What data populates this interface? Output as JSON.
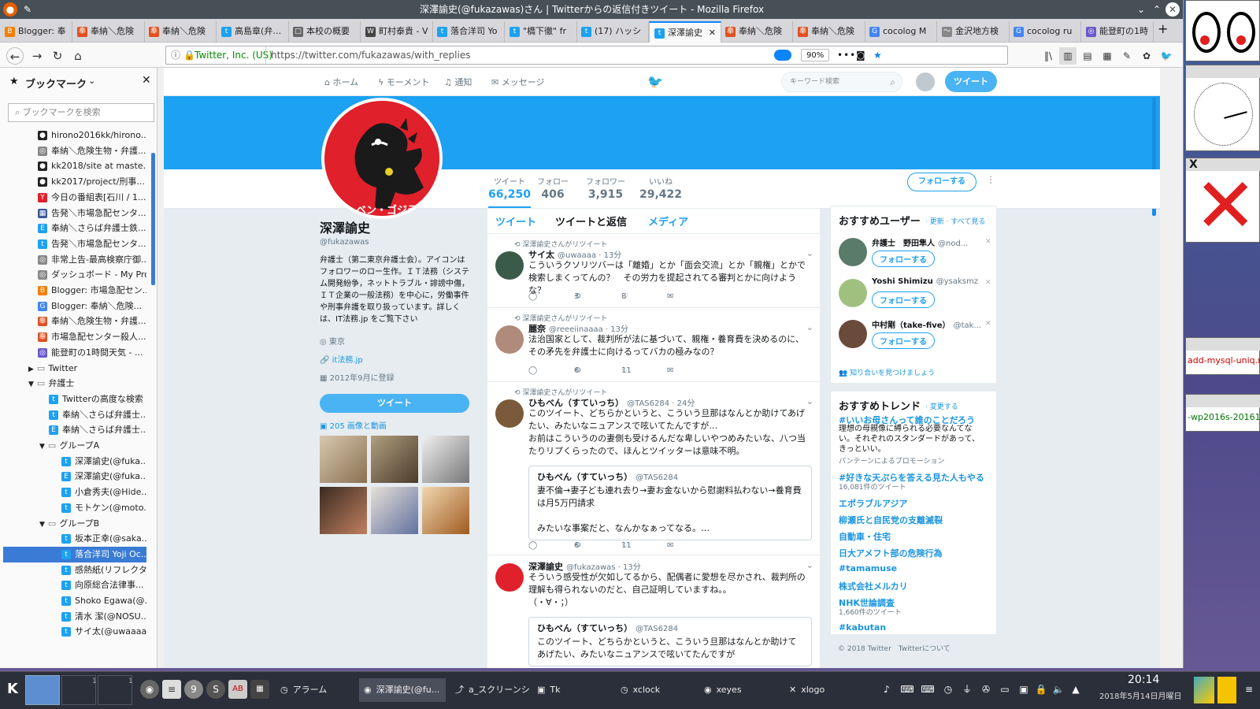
{
  "window": {
    "title": "深澤諭史(@fukazawas)さん | Twitterからの返信付きツイート - Mozilla Firefox"
  },
  "tabs": [
    {
      "label": "Blogger: 奉",
      "color": "#f57d00",
      "icon": "B"
    },
    {
      "label": "奉納＼危険",
      "color": "#e05020",
      "icon": "奉"
    },
    {
      "label": "奉納＼危険",
      "color": "#e05020",
      "icon": "奉"
    },
    {
      "label": "高島章(弁…",
      "color": "#1da1f2",
      "icon": "t"
    },
    {
      "label": "本校の概要",
      "color": "#666",
      "icon": "□"
    },
    {
      "label": "町村泰貴 - V",
      "color": "#444",
      "icon": "W"
    },
    {
      "label": "落合洋司 Yo",
      "color": "#1da1f2",
      "icon": "t"
    },
    {
      "label": "\"橋下徹\" fr",
      "color": "#1da1f2",
      "icon": "t"
    },
    {
      "label": "(17) ハッシ",
      "color": "#1da1f2",
      "icon": "t"
    },
    {
      "label": "深澤諭史",
      "color": "#1da1f2",
      "icon": "t",
      "active": true
    },
    {
      "label": "奉納＼危険",
      "color": "#e05020",
      "icon": "奉"
    },
    {
      "label": "奉納＼危険",
      "color": "#e05020",
      "icon": "奉"
    },
    {
      "label": "cocolog M",
      "color": "#4285f4",
      "icon": "G"
    },
    {
      "label": "金沢地方検",
      "color": "#888",
      "icon": "〜"
    },
    {
      "label": "cocolog ru",
      "color": "#4285f4",
      "icon": "G"
    },
    {
      "label": "能登町の1時",
      "color": "#6a5acd",
      "icon": "◎"
    }
  ],
  "nav": {
    "identity": "Twitter, Inc. (US)",
    "url": "https://twitter.com/fukazawas/with_replies",
    "zoom": "90%"
  },
  "sidebar": {
    "title": "ブックマーク",
    "search_placeholder": "ブックマークを検索",
    "items": [
      {
        "label": "hirono2016kk/hirono...",
        "indent": 0,
        "color": "#222",
        "icon": "●"
      },
      {
        "label": "奉納＼危険生物・弁護...",
        "indent": 0,
        "color": "#888",
        "icon": "◎"
      },
      {
        "label": "kk2018/site at maste...",
        "indent": 0,
        "color": "#222",
        "icon": "●"
      },
      {
        "label": "kk2017/project/刑事...",
        "indent": 0,
        "color": "#222",
        "icon": "●"
      },
      {
        "label": "今日の番組表[石川 / 1...",
        "indent": 0,
        "color": "#e0202a",
        "icon": "Y"
      },
      {
        "label": "告発＼市場急配センタ...",
        "indent": 0,
        "color": "#3b5998",
        "icon": "▦"
      },
      {
        "label": "奉納＼さらば弁護士鉄...",
        "indent": 0,
        "color": "#1da1f2",
        "icon": "E"
      },
      {
        "label": "告発＼市場急配センタ...",
        "indent": 0,
        "color": "#1da1f2",
        "icon": "t"
      },
      {
        "label": "非常上告-最高検察庁御...",
        "indent": 0,
        "color": "#888",
        "icon": "◎"
      },
      {
        "label": "ダッシュボード - My Pro...",
        "indent": 0,
        "color": "#888",
        "icon": "◎"
      },
      {
        "label": "Blogger: 市場急配セン...",
        "indent": 0,
        "color": "#f57d00",
        "icon": "B"
      },
      {
        "label": "Blogger: 奉納＼危険...",
        "indent": 0,
        "color": "#4285f4",
        "icon": "G"
      },
      {
        "label": "奉納＼危険生物・弁護...",
        "indent": 0,
        "color": "#e05020",
        "icon": "奉"
      },
      {
        "label": "市場急配センター殺人...",
        "indent": 0,
        "color": "#e05020",
        "icon": "奉"
      },
      {
        "label": "能登町の1時間天気 - ...",
        "indent": 0,
        "color": "#6a5acd",
        "icon": "◎"
      },
      {
        "label": "Twitter",
        "indent": 0,
        "folder": true,
        "collapsed": true
      },
      {
        "label": "弁護士",
        "indent": 0,
        "folder": true
      },
      {
        "label": "Twitterの高度な検索",
        "indent": 1,
        "color": "#1da1f2",
        "icon": "t"
      },
      {
        "label": "奉納＼さらば弁護士...",
        "indent": 1,
        "color": "#1da1f2",
        "icon": "t"
      },
      {
        "label": "奉納＼さらば弁護士...",
        "indent": 1,
        "color": "#1da1f2",
        "icon": "E"
      },
      {
        "label": "グループA",
        "indent": 1,
        "folder": true
      },
      {
        "label": "深澤諭史(@fuka...",
        "indent": 2,
        "color": "#1da1f2",
        "icon": "t"
      },
      {
        "label": "深澤諭史(@fuka...",
        "indent": 2,
        "color": "#1da1f2",
        "icon": "E"
      },
      {
        "label": "小倉秀夫(@Hide...",
        "indent": 2,
        "color": "#1da1f2",
        "icon": "t"
      },
      {
        "label": "モトケン(@moto...",
        "indent": 2,
        "color": "#1da1f2",
        "icon": "t"
      },
      {
        "label": "グループB",
        "indent": 1,
        "folder": true
      },
      {
        "label": "坂本正幸(@saka...",
        "indent": 2,
        "color": "#1da1f2",
        "icon": "t"
      },
      {
        "label": "落合洋司 Yoji Oc...",
        "indent": 2,
        "color": "#1da1f2",
        "icon": "t",
        "selected": true
      },
      {
        "label": "感熱紙(リフレクタ...",
        "indent": 2,
        "color": "#1da1f2",
        "icon": "t"
      },
      {
        "label": "向原総合法律事...",
        "indent": 2,
        "color": "#1da1f2",
        "icon": "t"
      },
      {
        "label": "Shoko Egawa(@...",
        "indent": 2,
        "color": "#1da1f2",
        "icon": "t"
      },
      {
        "label": "清水 潔(@NOSU...",
        "indent": 2,
        "color": "#1da1f2",
        "icon": "t"
      },
      {
        "label": "サイ太(@uwaaaa...",
        "indent": 2,
        "color": "#1da1f2",
        "icon": "t"
      }
    ]
  },
  "twitter": {
    "nav": {
      "home": "ホーム",
      "moments": "モーメント",
      "notifications": "通知",
      "messages": "メッセージ",
      "search_placeholder": "キーワード検索",
      "tweet_btn": "ツイート"
    },
    "stats": [
      {
        "label": "ツイート",
        "value": "66,250",
        "active": true
      },
      {
        "label": "フォロー",
        "value": "406"
      },
      {
        "label": "フォロワー",
        "value": "3,915"
      },
      {
        "label": "いいね",
        "value": "29,422"
      }
    ],
    "follow_btn": "フォローする",
    "profile": {
      "name": "深澤諭史",
      "handle": "@fukazawas",
      "bio": "弁護士（第二東京弁護士会）。アイコンはフォロワーのロー生作。ＩＴ法務（システム開発紛争，ネットトラブル・誹謗中傷，ＩＴ企業の一般法務）を中心に，労働事件や刑事弁護を取り扱っています。詳しくは、IT法務.jp をご覧下さい",
      "location": "東京",
      "website": "it法務.jp",
      "joined": "2012年9月に登録",
      "tweet_btn": "ツイート",
      "media_label": "205 画像と動画",
      "avatar_text": "ベン・ゴジラ"
    },
    "tabs": [
      "ツイート",
      "ツイートと返信",
      "メディア"
    ],
    "tweets": [
      {
        "rt": "深澤諭史さんがリツイート",
        "name": "サイ太",
        "handle": "@uwaaaa · 13分",
        "text": "こういうクソリツバーは「離婚」とか「面会交流」とか「親権」とかで検索しまくってんの？　その労力を提起されてる審判とかに向けような？",
        "reply": "",
        "retweets": "3",
        "likes": "8",
        "avcolor": "#3a5a4a"
      },
      {
        "rt": "深澤諭史さんがリツイート",
        "name": "麗奈",
        "handle": "@reeeiinaaaa · 13分",
        "text": "法治国家として、裁判所が法に基づいて、親権・養育費を決めるのに、その矛先を弁護士に向けるってバカの極みなの？",
        "reply": "",
        "retweets": "6",
        "likes": "11",
        "avcolor": "#b08a7a"
      },
      {
        "rt": "深澤諭史さんがリツイート",
        "name": "ひもべん（すていっち）",
        "handle": "@TAS6284 · 24分",
        "text": "このツイート、どちらかというと、こういう旦那はなんとか助けてあげたい、みたいなニュアンスで呟いてたんですが…\nお前はこういうのの妻側も受けるんだな卑しいやつめみたいな、八つ当たりリプくらったので、ほんとツイッターは意味不明。",
        "quote_name": "ひもべん（すていっち）",
        "quote_handle": "@TAS6284",
        "quote_text": "妻不倫→妻子ども連れ去り→妻お金ないから慰謝料払わない→養育費は月5万円請求\n\nみたいな事案だと、なんかなぁってなる。…",
        "reply": "",
        "retweets": "6",
        "likes": "11",
        "avcolor": "#7a5a3a"
      },
      {
        "rt": "",
        "name": "深澤諭史",
        "handle": "@fukazawas · 13分",
        "text": "そういう感受性が欠如してるから、配偶者に愛想を尽かされ、裁判所の理解も得られないのだと、自己証明していますね。。\n（・∀・；）",
        "quote_name": "ひもべん（すていっち）",
        "quote_handle": "@TAS6284",
        "quote_text": "このツイート、どちらかというと、こういう旦那はなんとか助けてあげたい、みたいなニュアンスで呟いてたんですが",
        "reply": "",
        "retweets": "",
        "likes": "",
        "avcolor": "#e0202a"
      }
    ],
    "wtf": {
      "title": "おすすめユーザー",
      "links": "· 更新 · すべて見る",
      "follow": "フォローする",
      "users": [
        {
          "name": "弁護士　野田隼人",
          "handle": "@nod...",
          "avcolor": "#5a7a6a"
        },
        {
          "name": "Yoshi Shimizu",
          "handle": "@ysaksmz",
          "avcolor": "#a0c080"
        },
        {
          "name": "中村剛（take-five）",
          "handle": "@tak...",
          "avcolor": "#6a4a3a"
        }
      ],
      "find": "知り合いを見つけましょう"
    },
    "trends": {
      "title": "おすすめトレンド",
      "change": "· 変更する",
      "items": [
        {
          "name": "#いいお母さんって誰のことだろう",
          "desc": "理想の母親像に縛られる必要なんてない。それぞれのスタンダードがあって、きっといい。",
          "promo": "パンテーンによるプロモーション"
        },
        {
          "name": "#好きな天ぷらを答える見た人もやる",
          "count": "16,081件のツイート"
        },
        {
          "name": "エポラブルアジア"
        },
        {
          "name": "柳瀬氏と自民党の支離滅裂"
        },
        {
          "name": "自動車・住宅"
        },
        {
          "name": "日大アメフト部の危険行為"
        },
        {
          "name": "#tamamuse"
        },
        {
          "name": "株式会社メルカリ"
        },
        {
          "name": "NHK世論調査",
          "count": "1,660件のツイート"
        },
        {
          "name": "#kabutan"
        }
      ],
      "footer": "© 2018 Twitter　Twitterについて"
    }
  },
  "right_panels": {
    "xlogo": "X",
    "xeyes_title": "",
    "mysql": "add-mysql-uniq.r",
    "wp": "-wp2016s-20161"
  },
  "taskbar": {
    "items": [
      "アラーム",
      "深澤諭史(@fu...",
      "a_スクリーンシ...",
      "Tk",
      "xclock",
      "xeyes",
      "xlogo"
    ],
    "time": "20:14",
    "date": "2018年5月14日月曜日",
    "desktop_num": "1"
  }
}
